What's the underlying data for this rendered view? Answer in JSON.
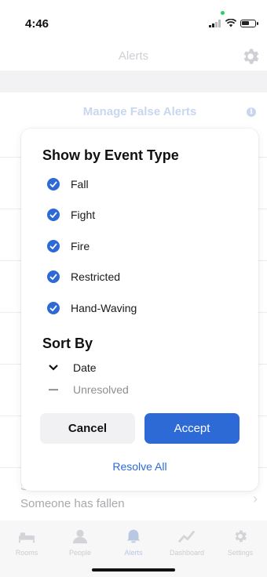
{
  "status_bar": {
    "time": "4:46"
  },
  "nav": {
    "title": "Alerts"
  },
  "manage": {
    "label": "Manage False Alerts"
  },
  "background_item": {
    "title": "Someone has fallen",
    "subtitle": "Someone has fallen"
  },
  "modal": {
    "title": "Show by Event Type",
    "event_types": [
      {
        "label": "Fall",
        "checked": true
      },
      {
        "label": "Fight",
        "checked": true
      },
      {
        "label": "Fire",
        "checked": true
      },
      {
        "label": "Restricted",
        "checked": true
      },
      {
        "label": "Hand-Waving",
        "checked": true
      }
    ],
    "sort_title": "Sort By",
    "sort_options": [
      {
        "label": "Date",
        "icon": "chevron-down-icon",
        "active": true
      },
      {
        "label": "Unresolved",
        "icon": "minus-icon",
        "active": false
      }
    ],
    "cancel_label": "Cancel",
    "accept_label": "Accept",
    "resolve_all_label": "Resolve All"
  },
  "tabs": [
    {
      "label": "Rooms",
      "icon": "bed-icon",
      "active": false
    },
    {
      "label": "People",
      "icon": "person-icon",
      "active": false
    },
    {
      "label": "Alerts",
      "icon": "bell-icon",
      "active": true
    },
    {
      "label": "Dashboard",
      "icon": "chart-icon",
      "active": false
    },
    {
      "label": "Settings",
      "icon": "gear-icon",
      "active": false
    }
  ],
  "colors": {
    "accent": "#2d6ad6",
    "check": "#2d6ad6",
    "cancel_bg": "#f1f1f3"
  }
}
